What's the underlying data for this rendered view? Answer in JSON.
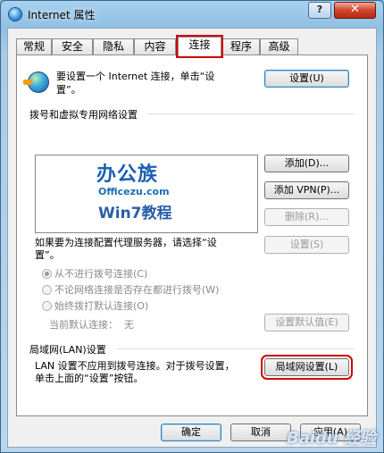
{
  "window": {
    "title": "Internet 属性",
    "help_label": "?",
    "close_label": "✕",
    "app_icon": "ie-icon"
  },
  "tabs": [
    {
      "label": "常规",
      "active": false
    },
    {
      "label": "安全",
      "active": false
    },
    {
      "label": "隐私",
      "active": false
    },
    {
      "label": "内容",
      "active": false
    },
    {
      "label": "连接",
      "active": true
    },
    {
      "label": "程序",
      "active": false
    },
    {
      "label": "高级",
      "active": false
    }
  ],
  "setup": {
    "icon": "globe-connect-icon",
    "text": "要设置一个 Internet 连接，单击“设置”。",
    "button": "设置(U)"
  },
  "dialup": {
    "group_label": "拨号和虚拟专用网络设置",
    "list_watermark": {
      "title": "办公族",
      "url": "Officezu.com",
      "subtitle": "Win7教程"
    },
    "add_button": "添加(D)...",
    "add_vpn_button": "添加 VPN(P)...",
    "remove_button": "删除(R)...",
    "proxy_text": "如果要为连接配置代理服务器，请选择“设置”。",
    "settings_button": "设置(S)",
    "options": [
      {
        "label": "从不进行拨号连接(C)",
        "checked": true
      },
      {
        "label": "不论网络连接是否存在都进行拨号(W)",
        "checked": false
      },
      {
        "label": "始终拨打默认连接(O)",
        "checked": false
      }
    ],
    "current_default_label": "当前默认连接：",
    "current_default_value": "无",
    "set_default_button": "设置默认值(E)"
  },
  "lan": {
    "group_label": "局域网(LAN)设置",
    "text": "LAN 设置不应用到拨号连接。对于拨号设置，单击上面的“设置”按钮。",
    "button": "局域网设置(L)"
  },
  "footer": {
    "ok": "确定",
    "cancel": "取消",
    "apply": "应用(A)"
  },
  "page_watermark": "Baidu 经验"
}
